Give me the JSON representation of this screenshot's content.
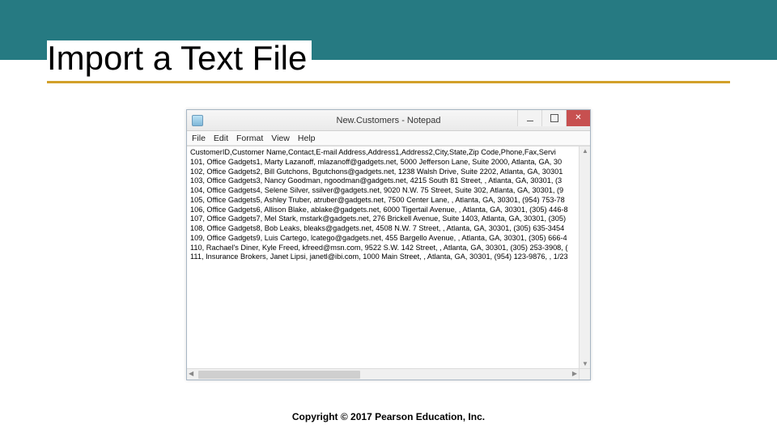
{
  "slide": {
    "title": "Import a Text File",
    "copyright": "Copyright © 2017 Pearson Education, Inc."
  },
  "notepad": {
    "window_title": "New.Customers - Notepad",
    "menu": {
      "file": "File",
      "edit": "Edit",
      "format": "Format",
      "view": "View",
      "help": "Help"
    },
    "lines": [
      "CustomerID,Customer Name,Contact,E-mail Address,Address1,Address2,City,State,Zip Code,Phone,Fax,Servi",
      "101, Office Gadgets1, Marty Lazanoff, mlazanoff@gadgets.net, 5000 Jefferson Lane, Suite 2000, Atlanta, GA, 30",
      "102, Office Gadgets2, Bill Gutchons, Bgutchons@gadgets.net, 1238 Walsh Drive, Suite 2202, Atlanta, GA, 30301",
      "103, Office Gadgets3, Nancy Goodman, ngoodman@gadgets.net, 4215 South 81 Street, , Atlanta, GA, 30301, (3",
      "104, Office Gadgets4, Selene Silver, ssilver@gadgets.net, 9020 N.W. 75 Street, Suite 302, Atlanta, GA, 30301, (9",
      "105, Office Gadgets5, Ashley Truber, atruber@gadgets.net, 7500 Center Lane, , Atlanta, GA, 30301, (954) 753-78",
      "106, Office Gadgets6, Allison Blake, ablake@gadgets.net, 6000 Tigertail Avenue, , Atlanta, GA, 30301, (305) 446-8",
      "107, Office Gadgets7, Mel Stark, mstark@gadgets.net, 276 Brickell Avenue, Suite 1403, Atlanta, GA, 30301, (305)",
      "108, Office Gadgets8, Bob Leaks, bleaks@gadgets.net, 4508 N.W. 7 Street, , Atlanta, GA, 30301, (305) 635-3454",
      "109, Office Gadgets9, Luis Cartego, lcatego@gadgets.net, 455 Bargello Avenue, , Atlanta, GA, 30301, (305) 666-4",
      "110, Rachael's Diner, Kyle Freed, kfreed@msn.com, 9522 S.W. 142 Street, , Atlanta, GA, 30301, (305) 253-3908, (",
      "111, Insurance Brokers, Janet Lipsi, janetl@ibi.com, 1000 Main Street, , Atlanta, GA, 30301, (954) 123-9876, , 1/23"
    ]
  }
}
